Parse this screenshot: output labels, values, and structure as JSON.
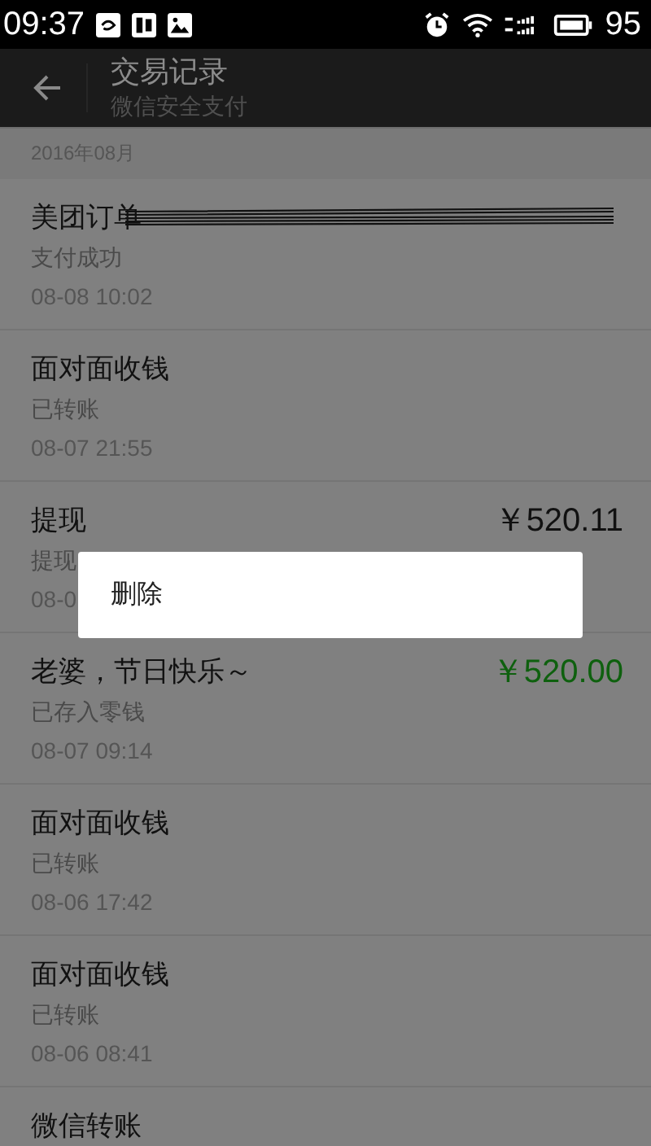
{
  "status_bar": {
    "time": "09:37",
    "battery": "95"
  },
  "header": {
    "title": "交易记录",
    "subtitle": "微信安全支付"
  },
  "section": "2016年08月",
  "records": [
    {
      "title": "美团订单",
      "subtitle": "支付成功",
      "time": "08-08 10:02",
      "scribbled": true
    },
    {
      "title": "面对面收钱",
      "subtitle": "已转账",
      "time": "08-07 21:55"
    },
    {
      "title": "提现",
      "subtitle": "提现",
      "time": "08-0",
      "amount": "￥520.11",
      "income": false
    },
    {
      "title": "老婆，节日快乐～",
      "subtitle": "已存入零钱",
      "time": "08-07 09:14",
      "amount": "￥520.00",
      "income": true
    },
    {
      "title": "面对面收钱",
      "subtitle": "已转账",
      "time": "08-06 17:42"
    },
    {
      "title": "面对面收钱",
      "subtitle": "已转账",
      "time": "08-06 08:41"
    },
    {
      "title": "微信转账"
    }
  ],
  "context_menu": {
    "items": [
      "删除"
    ]
  }
}
